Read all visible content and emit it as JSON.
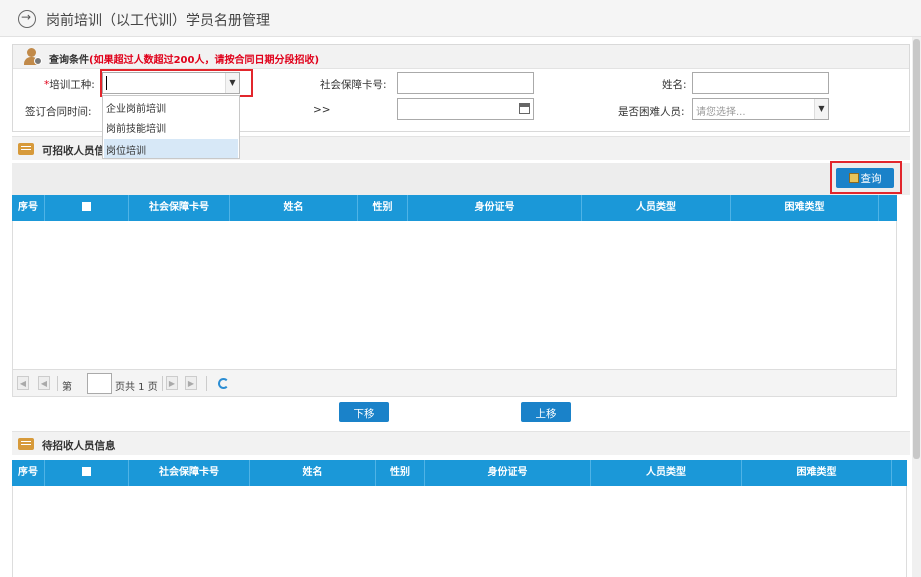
{
  "header": {
    "title": "岗前培训（以工代训）学员名册管理"
  },
  "query": {
    "title": "查询条件",
    "warning": "(如果超过人数超过200人，请按合同日期分段招收)",
    "fields": {
      "training_type_label": "培训工种:",
      "training_type_value": "",
      "social_card_label": "社会保障卡号:",
      "name_label": "姓名:",
      "contract_date_label": "签订合同时间:",
      "range_sep": ">>",
      "hardship_label": "是否困难人员:",
      "hardship_placeholder": "请您选择..."
    },
    "dropdown_options": [
      "企业岗前培训",
      "岗前技能培训",
      "岗位培训"
    ],
    "dropdown_selected_index": 2
  },
  "recruitable": {
    "title": "可招收人员信息",
    "query_button": "查询"
  },
  "grid": {
    "columns": [
      "序号",
      "",
      "社会保障卡号",
      "姓名",
      "性别",
      "身份证号",
      "人员类型",
      "困难类型"
    ]
  },
  "pager": {
    "page_prefix": "第",
    "page_value": "",
    "page_suffix": "页共 1 页"
  },
  "actions": {
    "move_down": "下移",
    "move_up": "上移"
  },
  "pending": {
    "title": "待招收人员信息"
  },
  "colors": {
    "accent": "#1b98d8",
    "highlight": "#e2262c",
    "warning": "#e0001a"
  }
}
